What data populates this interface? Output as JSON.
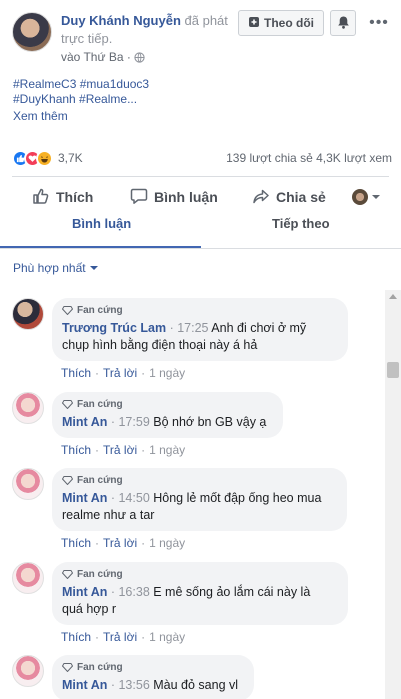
{
  "post": {
    "author": "Duy Khánh Nguyễn",
    "action_text": " đã phát trực tiếp.",
    "time": "vào Thứ Ba · ",
    "hashtags_line1": "#RealmeC3 #mua1duoc3",
    "hashtags_line2": "#DuyKhanh #Realme...",
    "see_more": "Xem thêm"
  },
  "header_buttons": {
    "follow_label": "Theo dõi",
    "more_label": "•••"
  },
  "stats": {
    "reaction_count": "3,7K",
    "shares_views": "139 lượt chia sẻ  4,3K lượt xem"
  },
  "actions": {
    "like": "Thích",
    "comment": "Bình luận",
    "share": "Chia sẻ"
  },
  "tabs": {
    "comments": "Bình luận",
    "next": "Tiếp theo"
  },
  "sort": {
    "label": "Phù hợp nhất"
  },
  "comments": [
    {
      "badge": "Fan cứng",
      "name": "Trương Trúc Lam",
      "time": "17:25",
      "text_line1": "Anh đi chơi ở mỹ",
      "text_line2": "chụp hình bằng điện thoại này á hả",
      "like": "Thích",
      "reply": "Trả lời",
      "age": "1 ngày"
    },
    {
      "badge": "Fan cứng",
      "name": "Mint An",
      "time": "17:59",
      "text_line1": "Bộ nhớ bn GB vậy ạ",
      "text_line2": "",
      "like": "Thích",
      "reply": "Trả lời",
      "age": "1 ngày"
    },
    {
      "badge": "Fan cứng",
      "name": "Mint An",
      "time": "14:50",
      "text_line1": "Hông lẻ mốt đập ống heo mua",
      "text_line2": "realme như a tar",
      "like": "Thích",
      "reply": "Trả lời",
      "age": "1 ngày"
    },
    {
      "badge": "Fan cứng",
      "name": "Mint An",
      "time": "16:38",
      "text_line1": "E mê sống ảo lắm cái này là",
      "text_line2": "quá hợp r",
      "like": "Thích",
      "reply": "Trả lời",
      "age": "1 ngày"
    },
    {
      "badge": "Fan cứng",
      "name": "Mint An",
      "time": "13:56",
      "text_line1": "Màu đỏ sang vl",
      "text_line2": ""
    }
  ],
  "colors": {
    "link": "#365899",
    "accent": "#4267b2",
    "bubble": "#f2f3f5"
  }
}
